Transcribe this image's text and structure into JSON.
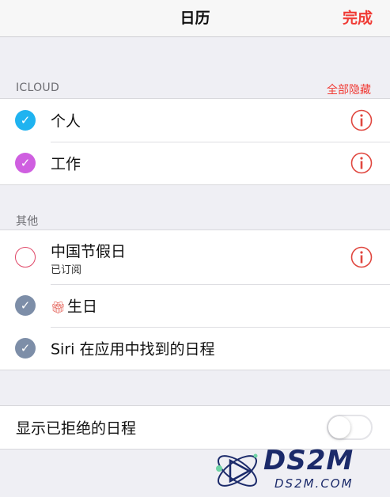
{
  "navbar": {
    "title": "日历",
    "done_label": "完成"
  },
  "icloud": {
    "header": "ICLOUD",
    "hide_all_label": "全部隐藏",
    "items": [
      {
        "title": "个人",
        "check_color": "#1fb3f0",
        "checked": true
      },
      {
        "title": "工作",
        "check_color": "#cf5fe0",
        "checked": true
      }
    ]
  },
  "other": {
    "header": "其他",
    "items": [
      {
        "title": "中国节假日",
        "subtitle": "已订阅",
        "check_color": "#e04868",
        "checked": false
      },
      {
        "title": "生日",
        "check_color": "#7d8ea8",
        "checked": true,
        "icon": "gift-icon"
      },
      {
        "title": "Siri 在应用中找到的日程",
        "check_color": "#7d8ea8",
        "checked": true
      }
    ]
  },
  "declined": {
    "label": "显示已拒绝的日程",
    "enabled": false
  },
  "watermark": {
    "logo_text": "DS2M",
    "url_text": "DS2M.COM"
  },
  "colors": {
    "accent": "#f03b35",
    "info": "#e0473f"
  }
}
